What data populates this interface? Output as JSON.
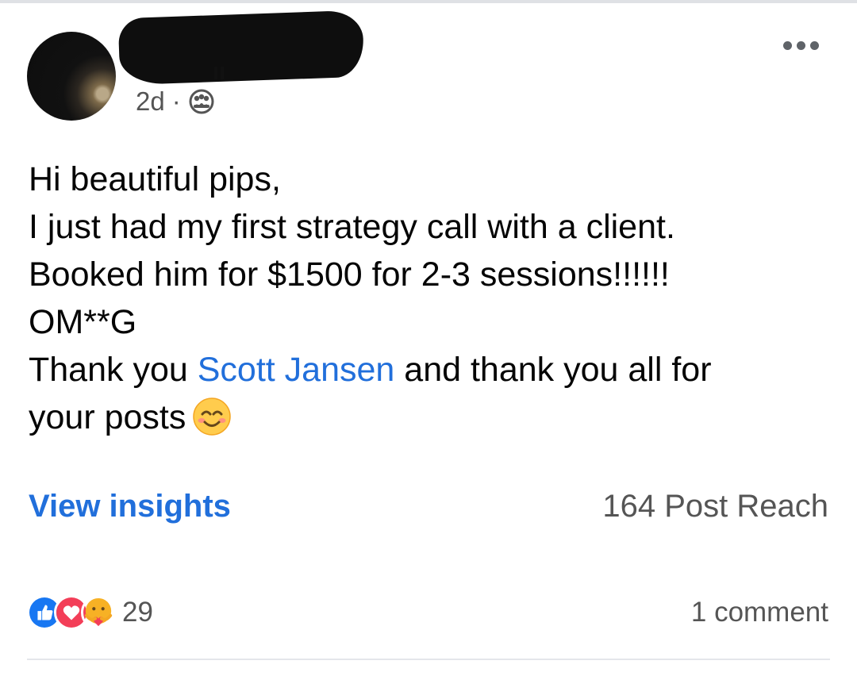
{
  "post": {
    "time_ago": "2d",
    "separator": "·",
    "audience_icon": "group-icon",
    "menu_icon": "more-options-icon",
    "body_lines": [
      "Hi beautiful pips,",
      "I just had my first strategy call with a client.",
      "Booked him for $1500 for 2-3 sessions!!!!!!",
      "OM**G"
    ],
    "thanks_prefix": "Thank you ",
    "mention": "Scott Jansen",
    "thanks_suffix": " and thank you all for",
    "last_line": "your posts",
    "emoji": "smiling-face-icon"
  },
  "insights": {
    "link_label": "View insights",
    "reach": "164 Post Reach"
  },
  "footer": {
    "reaction_icons": [
      "like-icon",
      "love-icon",
      "care-icon"
    ],
    "reaction_count": "29",
    "comments": "1 comment"
  },
  "colors": {
    "link": "#216fdb",
    "like": "#1877f2",
    "love": "#f33e58",
    "care": "#f7b125"
  }
}
